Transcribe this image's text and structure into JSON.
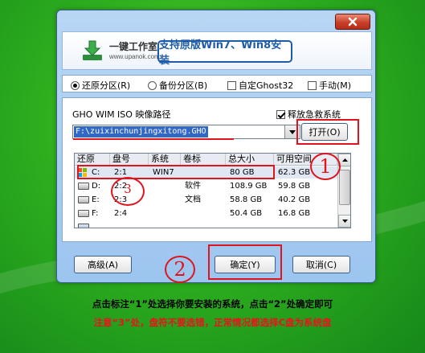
{
  "window": {
    "brand_name": "一键工作室",
    "brand_url": "www.upanok.com",
    "slogan": "支持原版Win7、Win8安装",
    "close_icon": "close-x-icon"
  },
  "options": {
    "restore_partition": "还原分区(R)",
    "backup_partition": "备份分区(B)",
    "custom_ghost": "自定Ghost32",
    "manual": "手动(M)",
    "selected": "restore_partition"
  },
  "image_path": {
    "label": "GHO WIM ISO 映像路径",
    "release_rescue": "释放急救系统",
    "release_rescue_checked": true,
    "value": "F:\\zuixinchunjingxitong.GHO",
    "open_button": "打开(O)"
  },
  "partition_table": {
    "columns": [
      "还原",
      "盘号",
      "系统",
      "卷标",
      "总大小",
      "可用空间"
    ],
    "rows": [
      {
        "drive": "C:",
        "disk": "2:1",
        "system": "WIN7",
        "label": "",
        "total": "80 GB",
        "free": "62.3 GB",
        "icon": "windows-drive-icon"
      },
      {
        "drive": "D:",
        "disk": "2:2",
        "system": "",
        "label": "软件",
        "total": "108.9 GB",
        "free": "59.8 GB",
        "icon": "hard-disk-icon"
      },
      {
        "drive": "E:",
        "disk": "2:3",
        "system": "",
        "label": "文档",
        "total": "58.8 GB",
        "free": "40.2 GB",
        "icon": "hard-disk-icon"
      },
      {
        "drive": "F:",
        "disk": "2:4",
        "system": "",
        "label": "",
        "total": "50.4 GB",
        "free": "16.8 GB",
        "icon": "hard-disk-icon"
      },
      {
        "drive": "",
        "disk": "",
        "system": "",
        "label": "",
        "total": "",
        "free": "",
        "icon": "usb-drive-icon"
      }
    ]
  },
  "buttons": {
    "advanced": "高级(A)",
    "ok": "确定(Y)",
    "cancel": "取消(C)"
  },
  "annotations": {
    "marker_1": "1",
    "marker_2": "2",
    "marker_3": "3"
  },
  "captions": {
    "line1": "点击标注“1”处选择你要安装的系统，点击“2”处确定即可",
    "line2": "注意“3”处，盘符不要选错，正常情况都选择C盘为系统盘"
  },
  "colors": {
    "annotation": "#e0141c",
    "accent": "#1e5ca8"
  }
}
